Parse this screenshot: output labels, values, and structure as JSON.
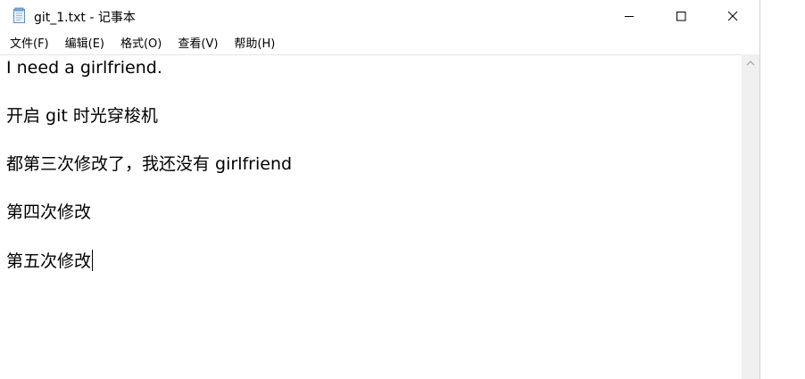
{
  "window": {
    "title": "git_1.txt - 记事本",
    "app_icon": "notepad-icon",
    "controls": {
      "minimize_icon": "minimize-icon",
      "maximize_icon": "maximize-icon",
      "close_icon": "close-icon"
    }
  },
  "menu": {
    "items": [
      {
        "label": "文件(F)"
      },
      {
        "label": "编辑(E)"
      },
      {
        "label": "格式(O)"
      },
      {
        "label": "查看(V)"
      },
      {
        "label": "帮助(H)"
      }
    ]
  },
  "editor": {
    "lines": [
      "I need a girlfriend.",
      "开启 git 时光穿梭机",
      "都第三次修改了，我还没有 girlfriend",
      "第四次修改",
      "第五次修改"
    ]
  },
  "colors": {
    "background": "#ffffff",
    "text": "#000000",
    "scrollbar": "#f0f0f0"
  }
}
